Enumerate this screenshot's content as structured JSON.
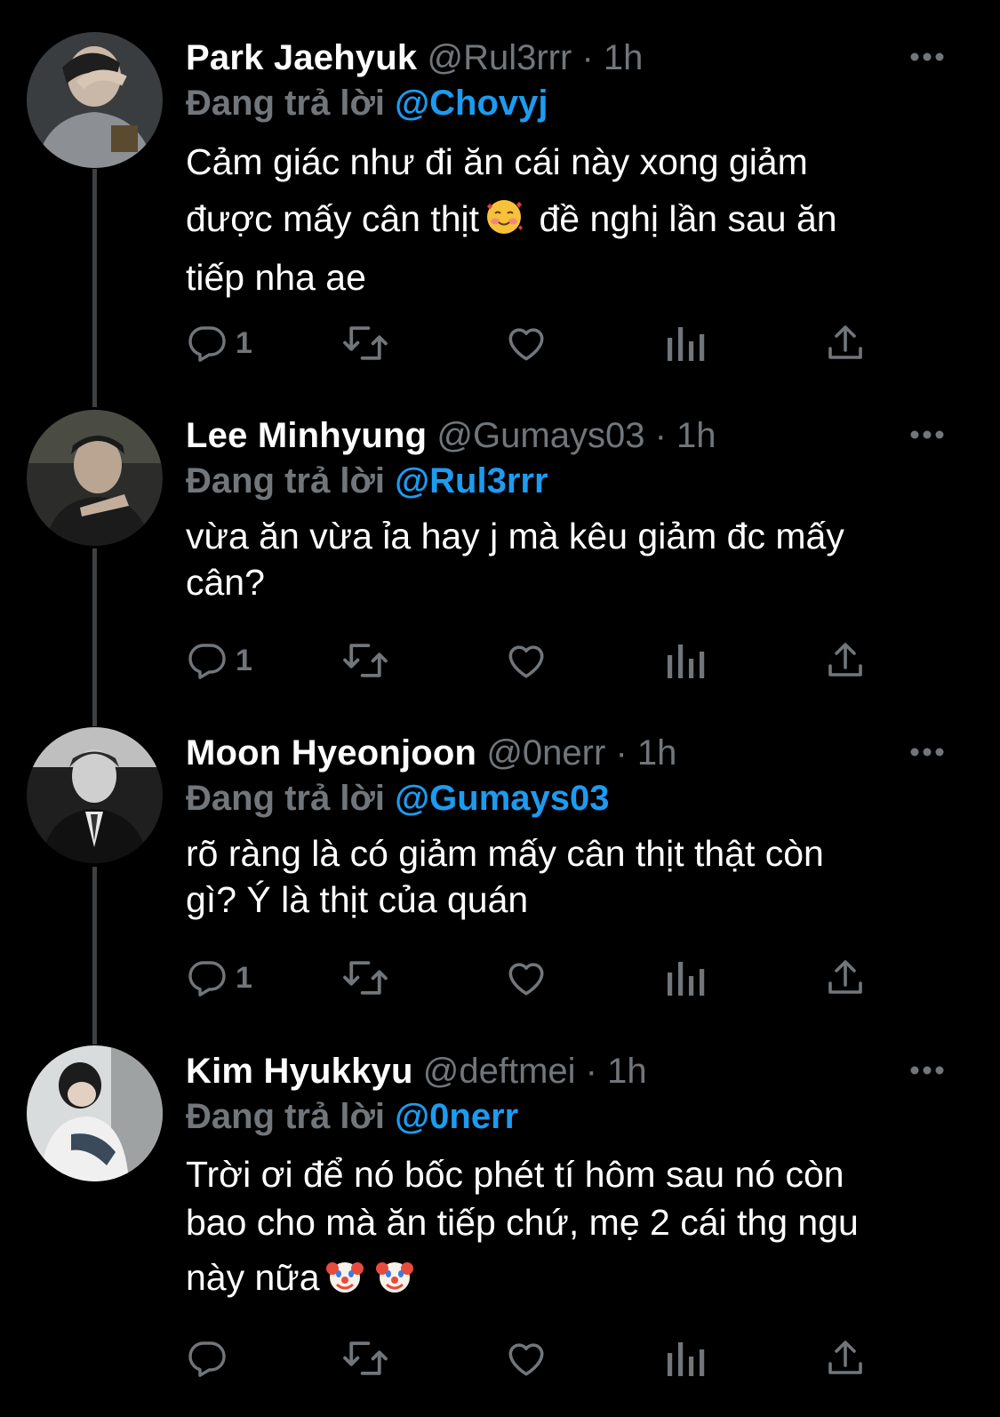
{
  "colors": {
    "background": "#000000",
    "name": "#ffffff",
    "muted": "#71767b",
    "mention": "#1d9bf0",
    "thread_line": "#3e4144"
  },
  "icons": {
    "more": "more-horizontal-icon",
    "reply": "reply-icon",
    "retweet": "retweet-icon",
    "like": "heart-icon",
    "views": "views-icon",
    "share": "share-icon"
  },
  "tweets": [
    {
      "name": "Park Jaehyuk",
      "handle": "@Rul3rrr",
      "dot": "·",
      "time": "1h",
      "reply_prefix": "Đang trả lời",
      "reply_mention": "@Chovyj",
      "text_lines": [
        "Cảm giác như đi ăn cái này xong giảm",
        "được mấy cân thịt",
        "đề nghị lần sau ăn",
        "tiếp nha ae"
      ],
      "emoji": "smiling-face-with-hearts-emoji",
      "reply_count": "1"
    },
    {
      "name": "Lee Minhyung",
      "handle": "@Gumays03",
      "dot": "·",
      "time": "1h",
      "reply_prefix": "Đang trả lời",
      "reply_mention": "@Rul3rrr",
      "text_lines": [
        "vừa ăn vừa ỉa hay j mà kêu giảm đc mấy",
        "cân?"
      ],
      "reply_count": "1"
    },
    {
      "name": "Moon Hyeonjoon",
      "handle": "@0nerr",
      "dot": "·",
      "time": "1h",
      "reply_prefix": "Đang trả lời",
      "reply_mention": "@Gumays03",
      "text_lines": [
        "rõ ràng là có giảm mấy cân thịt thật còn",
        "gì? Ý là thịt của quán"
      ],
      "reply_count": "1"
    },
    {
      "name": "Kim Hyukkyu",
      "handle": "@deftmei",
      "dot": "·",
      "time": "1h",
      "reply_prefix": "Đang trả lời",
      "reply_mention": "@0nerr",
      "text_lines": [
        "Trời ơi để nó bốc phét tí hôm sau nó còn",
        "bao cho mà ăn tiếp chứ, mẹ 2 cái thg ngu",
        "này nữa"
      ],
      "emoji": "clown-face-emoji",
      "reply_count": ""
    }
  ]
}
